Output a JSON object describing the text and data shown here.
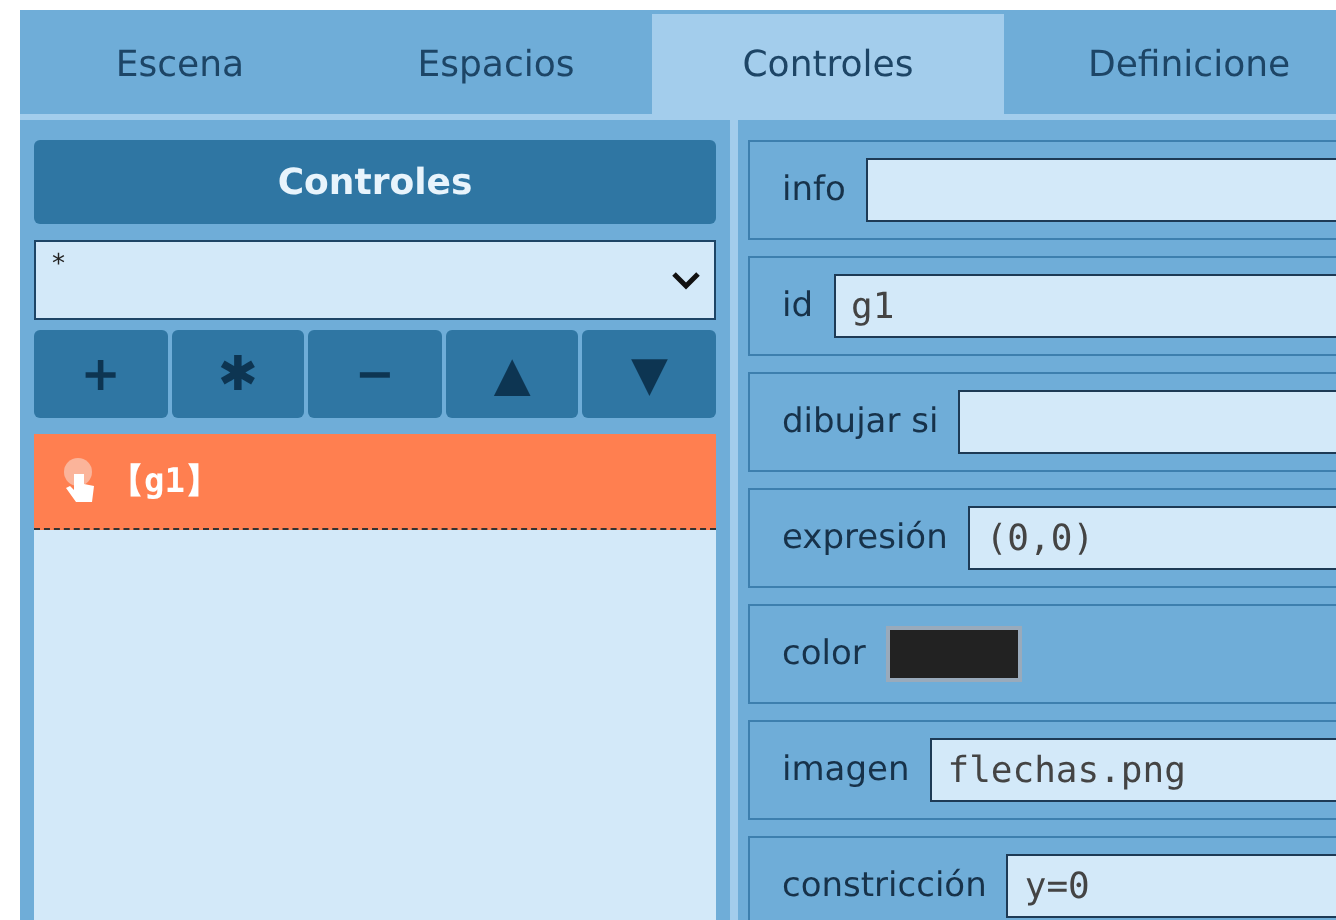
{
  "tabs": [
    {
      "label": "Escena",
      "selected": false
    },
    {
      "label": "Espacios",
      "selected": false
    },
    {
      "label": "Controles",
      "selected": true
    },
    {
      "label": "Definicione",
      "selected": false
    }
  ],
  "controls_panel": {
    "title": "Controles",
    "filter": {
      "value": "*"
    },
    "buttons": [
      "+",
      "✱",
      "−",
      "▲",
      "▼"
    ],
    "items": [
      {
        "label": "【g1】",
        "selected": true
      }
    ]
  },
  "properties": [
    {
      "kind": "text",
      "label": "info"
    },
    {
      "kind": "text",
      "label": "id",
      "value": "g1"
    },
    {
      "kind": "text",
      "label": "dibujar si"
    },
    {
      "kind": "text",
      "label": "expresión",
      "value": "(0,0)"
    },
    {
      "kind": "color",
      "label": "color",
      "color": "#222222"
    },
    {
      "kind": "text",
      "label": "imagen",
      "value": "flechas.png"
    },
    {
      "kind": "text",
      "label": "constricción",
      "value": "y=0"
    }
  ]
}
